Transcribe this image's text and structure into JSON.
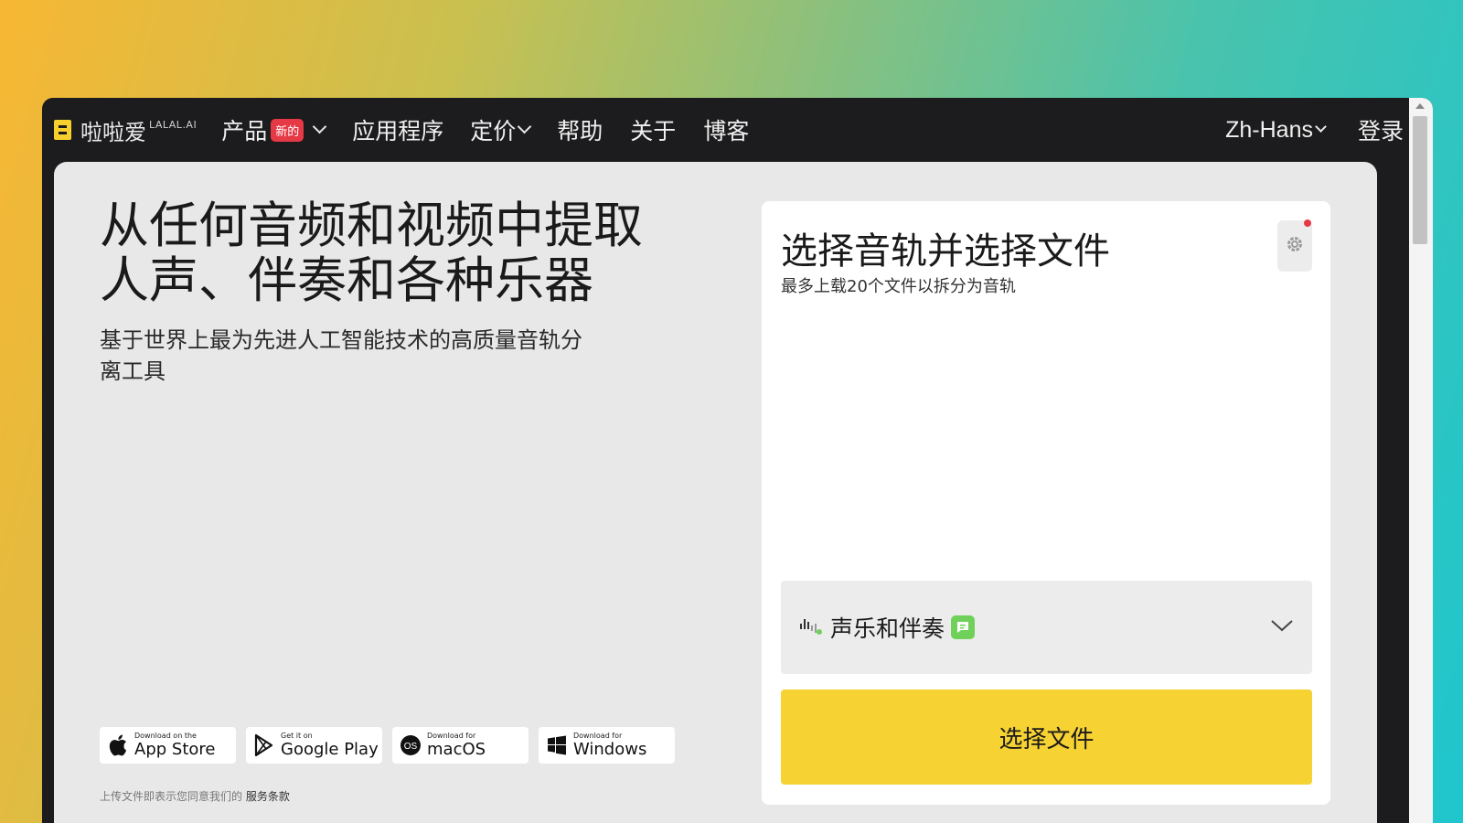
{
  "logo": {
    "text": "啦啦爱",
    "sup": "LALAL.AI"
  },
  "nav": {
    "products": "产品",
    "new_badge": "新的",
    "apps": "应用程序",
    "pricing": "定价",
    "help": "帮助",
    "about": "关于",
    "blog": "博客",
    "language": "Zh-Hans",
    "login": "登录"
  },
  "hero": {
    "title": "从任何音频和视频中提取人声、伴奏和各种乐器",
    "subtitle": "基于世界上最为先进人工智能技术的高质量音轨分离工具"
  },
  "stores": [
    {
      "small": "Download on the",
      "big": "App Store",
      "icon": "apple-icon"
    },
    {
      "small": "Get it on",
      "big": "Google Play",
      "icon": "google-play-icon"
    },
    {
      "small": "Download for",
      "big": "macOS",
      "icon": "macos-icon"
    },
    {
      "small": "Download for",
      "big": "Windows",
      "icon": "windows-icon"
    }
  ],
  "terms": {
    "prefix": "上传文件即表示您同意我们的",
    "link": "服务条款"
  },
  "card": {
    "title": "选择音轨并选择文件",
    "subtitle": "最多上载20个文件以拆分为音轨",
    "stem_option": "声乐和伴奏",
    "select_button": "选择文件"
  },
  "colors": {
    "accent_yellow": "#f6d232",
    "badge_red": "#e63946",
    "stem_green": "#6fd15a",
    "nav_bg": "#1c1b1d"
  }
}
